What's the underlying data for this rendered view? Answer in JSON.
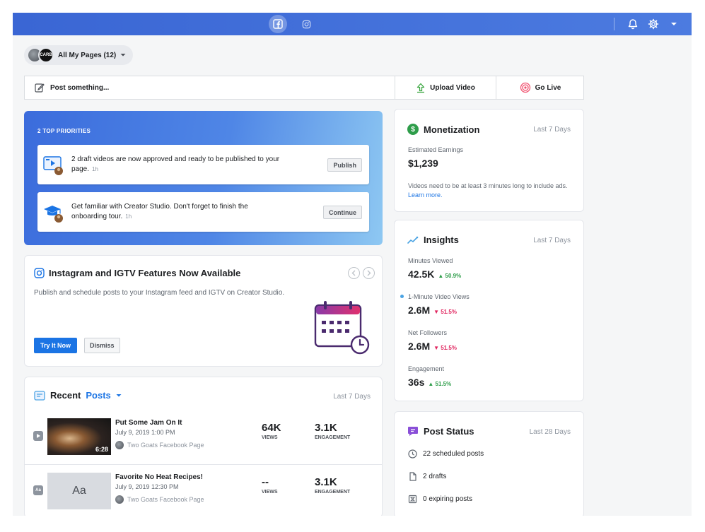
{
  "create": {
    "post_label": "Post something...",
    "upload_label": "Upload Video",
    "live_label": "Go Live"
  },
  "pages": {
    "label": "All My Pages (12)",
    "avatar2_text": "CARB"
  },
  "priorities": {
    "title": "2 TOP PRIORITIES",
    "items": [
      {
        "text": "2 draft videos are now approved and ready to be published to your page.",
        "time": "1h",
        "button": "Publish"
      },
      {
        "text": "Get familiar with Creator Studio. Don't forget to finish the onboarding tour.",
        "time": "1h",
        "button": "Continue"
      }
    ]
  },
  "instagram": {
    "title": "Instagram and IGTV Features Now Available",
    "description": "Publish and schedule posts to your Instagram feed and IGTV on Creator Studio.",
    "try_button": "Try It Now",
    "dismiss_button": "Dismiss"
  },
  "recent_posts": {
    "title_prefix": "Recent",
    "title_link": "Posts",
    "range": "Last 7 Days",
    "rows": [
      {
        "title": "Put Some Jam On It",
        "date": "July 9, 2019 1:00 PM",
        "page": "Two Goats Facebook Page",
        "duration": "6:28",
        "views": "64K",
        "views_label": "VIEWS",
        "engagement": "3.1K",
        "engagement_label": "ENGAGEMENT",
        "type_badge": ""
      },
      {
        "title": "Favorite No Heat Recipes!",
        "date": "July 9, 2019 12:30 PM",
        "page": "Two Goats Facebook Page",
        "thumb_text": "Aa",
        "views": "--",
        "views_label": "VIEWS",
        "engagement": "3.1K",
        "engagement_label": "ENGAGEMENT",
        "type_badge": "Aa"
      }
    ]
  },
  "monetization": {
    "title": "Monetization",
    "range": "Last 7 Days",
    "earnings_label": "Estimated Earnings",
    "earnings_value": "$1,239",
    "note": "Videos need to be at least 3 minutes long to include ads.",
    "note_link": "Learn more."
  },
  "insights": {
    "title": "Insights",
    "range": "Last 7 Days",
    "metrics": [
      {
        "label": "Minutes Viewed",
        "value": "42.5K",
        "change": "50.9%",
        "direction": "up"
      },
      {
        "label": "1-Minute Video Views",
        "value": "2.6M",
        "change": "51.5%",
        "direction": "down"
      },
      {
        "label": "Net Followers",
        "value": "2.6M",
        "change": "51.5%",
        "direction": "down"
      },
      {
        "label": "Engagement",
        "value": "36s",
        "change": "51.5%",
        "direction": "up"
      }
    ]
  },
  "post_status": {
    "title": "Post Status",
    "range": "Last 28 Days",
    "items": [
      {
        "text": "22 scheduled posts",
        "icon": "clock-icon"
      },
      {
        "text": "2 drafts",
        "icon": "document-icon"
      },
      {
        "text": "0 expiring posts",
        "icon": "hourglass-icon"
      }
    ]
  },
  "colors": {
    "brand_blue": "#3a66d4",
    "accent": "#1b74e4",
    "positive": "#2e9d4a",
    "negative": "#e0245e"
  }
}
